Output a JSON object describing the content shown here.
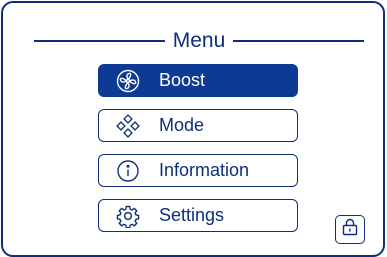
{
  "menu": {
    "title": "Menu",
    "items": [
      {
        "label": "Boost",
        "icon": "fan-icon",
        "active": true
      },
      {
        "label": "Mode",
        "icon": "mode-icon",
        "active": false
      },
      {
        "label": "Information",
        "icon": "info-icon",
        "active": false
      },
      {
        "label": "Settings",
        "icon": "gear-icon",
        "active": false
      }
    ]
  },
  "lock": {
    "icon": "lock-icon"
  },
  "colors": {
    "accent": "#0d2f7a",
    "active_bg": "#0d3a94",
    "background": "#ffffff"
  }
}
